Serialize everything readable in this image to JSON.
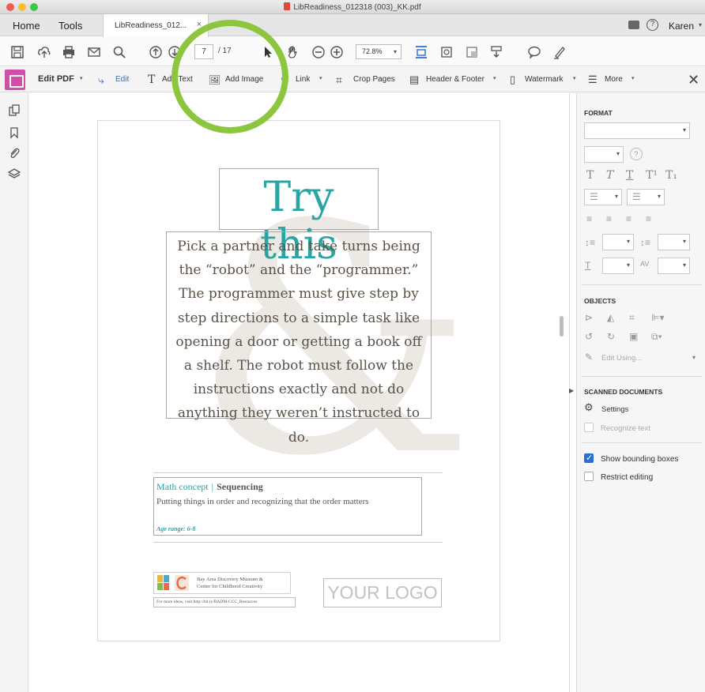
{
  "window": {
    "title": "LibReadiness_012318 (003)_KK.pdf"
  },
  "tabs": {
    "home": "Home",
    "tools": "Tools",
    "document": "LibReadiness_012...",
    "close": "×"
  },
  "user": {
    "name": "Karen",
    "help": "?"
  },
  "toolbar": {
    "page_current": "7",
    "page_total": "/ 17",
    "zoom": "72.8%"
  },
  "edit_bar": {
    "title": "Edit PDF",
    "edit": "Edit",
    "add_text": "Add Text",
    "add_image": "Add Image",
    "link": "Link",
    "crop_pages": "Crop Pages",
    "header_footer": "Header & Footer",
    "watermark": "Watermark",
    "more": "More"
  },
  "page": {
    "title": "Try this",
    "body": "Pick a partner and take turns being the “robot” and the “programmer.” The programmer must give step by step directions to a simple task like opening a door or getting a book off a shelf. The robot must follow the instructions exactly and not do anything they weren’t instructed to do.",
    "math_concept": "Math concept",
    "math_separator": "|",
    "math_topic": "Sequencing",
    "math_description": "Putting things in order and recognizing that the order matters",
    "age_range": "Age range: 6-8",
    "logo_text_1": "Bay Area Discovery Museum &",
    "logo_text_2": "Center for Childhood Creativity",
    "more_ideas": "For more ideas, visit http://bit.ly/BADM-CCC_Resources",
    "your_logo": "YOUR LOGO"
  },
  "panel": {
    "format": "FORMAT",
    "objects": "OBJECTS",
    "edit_using": "Edit Using...",
    "scanned": "SCANNED DOCUMENTS",
    "settings": "Settings",
    "recognize": "Recognize text",
    "show_boxes": "Show bounding boxes",
    "restrict": "Restrict editing"
  },
  "colors": {
    "accent_teal": "#2aa5a3",
    "highlight_green": "#8cc63f",
    "tool_magenta": "#d04fa8",
    "link_blue": "#2a6fd4"
  }
}
